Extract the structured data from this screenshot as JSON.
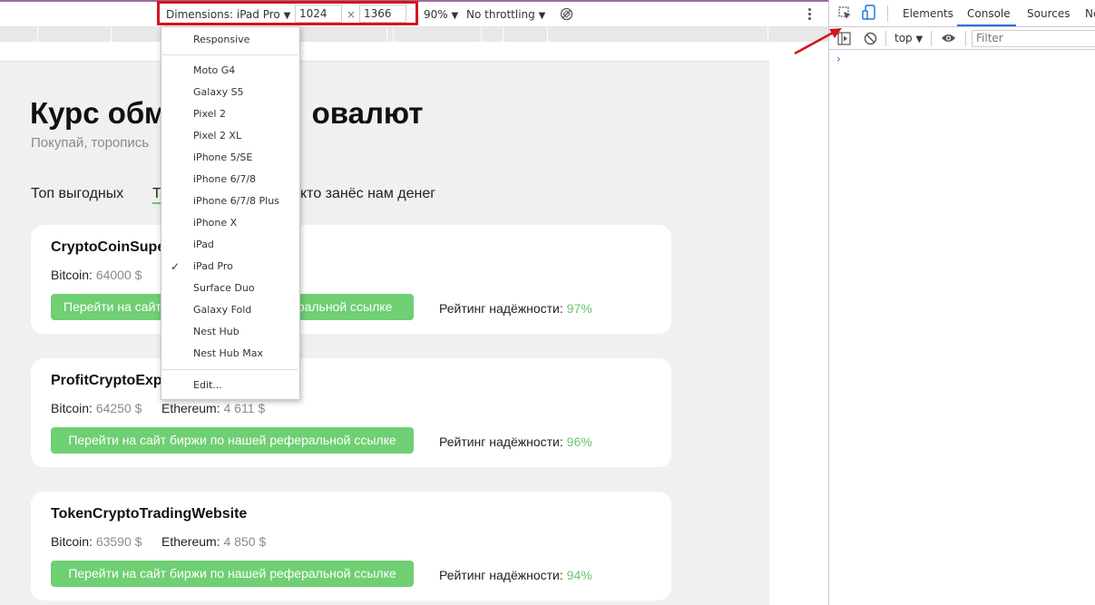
{
  "toolbar": {
    "dimensions_label": "Dimensions: iPad Pro",
    "width_value": "1024",
    "times_sign": "×",
    "height_value": "1366",
    "zoom_label": "90%",
    "throttling_label": "No throttling"
  },
  "device_menu": {
    "items": [
      "Responsive",
      "Moto G4",
      "Galaxy S5",
      "Pixel 2",
      "Pixel 2 XL",
      "iPhone 5/SE",
      "iPhone 6/7/8",
      "iPhone 6/7/8 Plus",
      "iPhone X",
      "iPad",
      "iPad Pro",
      "Surface Duo",
      "Galaxy Fold",
      "Nest Hub",
      "Nest Hub Max",
      "Edit..."
    ],
    "selected": "iPad Pro",
    "check_mark": "✓"
  },
  "page": {
    "title": "Курс обме",
    "title_tail": "овалют",
    "subtitle": "Покупай, торопись",
    "subtitle_tail": "ь",
    "tabs": [
      "Топ выгодных",
      "Т",
      "кто занёс нам денег"
    ],
    "cards": [
      {
        "title": "CryptoCoinSuper",
        "coins": [
          {
            "label": "Bitcoin: ",
            "value": "64000 $"
          }
        ],
        "cta_left": "Перейти на сайт",
        "cta_right": "еральной ссылке",
        "rating_label": "Рейтинг надёжности: ",
        "rating_value": "97%"
      },
      {
        "title": "ProfitCryptoExpe",
        "coins": [
          {
            "label": "Bitcoin: ",
            "value": "64250 $"
          },
          {
            "label": "Ethereum: ",
            "value": "4 611 $"
          }
        ],
        "cta": "Перейти на сайт биржи по нашей реферальной ссылке",
        "rating_label": "Рейтинг надёжности: ",
        "rating_value": "96%"
      },
      {
        "title": "TokenCryptoTradingWebsite",
        "coins": [
          {
            "label": "Bitcoin: ",
            "value": "63590 $"
          },
          {
            "label": "Ethereum: ",
            "value": "4 850 $"
          }
        ],
        "cta": "Перейти на сайт биржи по нашей реферальной ссылке",
        "rating_label": "Рейтинг надёжности: ",
        "rating_value": "94%"
      }
    ]
  },
  "devtools": {
    "tabs": [
      "Elements",
      "Console",
      "Sources",
      "Ne"
    ],
    "active_tab": "Console",
    "context": "top",
    "filter_placeholder": "Filter",
    "prompt": "›"
  },
  "colors": {
    "annotation_red": "#d6141e",
    "green_accent": "#6fcf73",
    "devtools_blue": "#1a73e8"
  }
}
